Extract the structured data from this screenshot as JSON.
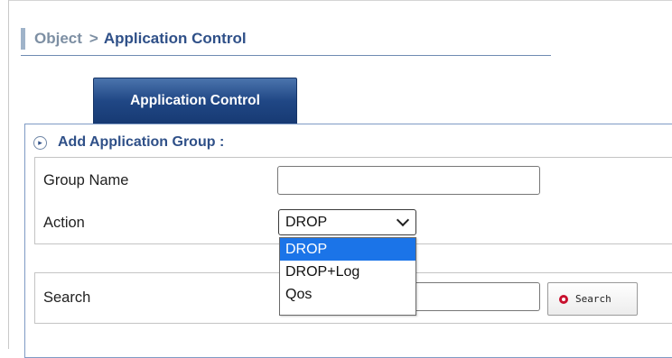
{
  "breadcrumb": {
    "root": "Object",
    "separator": ">",
    "current": "Application Control"
  },
  "tabs": [
    {
      "label": "Application Control",
      "active": true
    }
  ],
  "section": {
    "title": "Add Application Group :",
    "icon": "circle-arrow-right-icon"
  },
  "form": {
    "group_name_label": "Group Name",
    "group_name_value": "",
    "action_label": "Action",
    "action_selected": "DROP",
    "action_options": [
      "DROP",
      "DROP+Log",
      "Qos"
    ],
    "action_highlighted": "DROP"
  },
  "search": {
    "label": "Search",
    "value": "",
    "button_label": "Search",
    "button_icon": "red-circle-icon"
  },
  "colors": {
    "accent": "#2f5088",
    "tab_bg": "#204785",
    "option_highlight": "#1b74e8",
    "search_icon": "#c8102e"
  }
}
